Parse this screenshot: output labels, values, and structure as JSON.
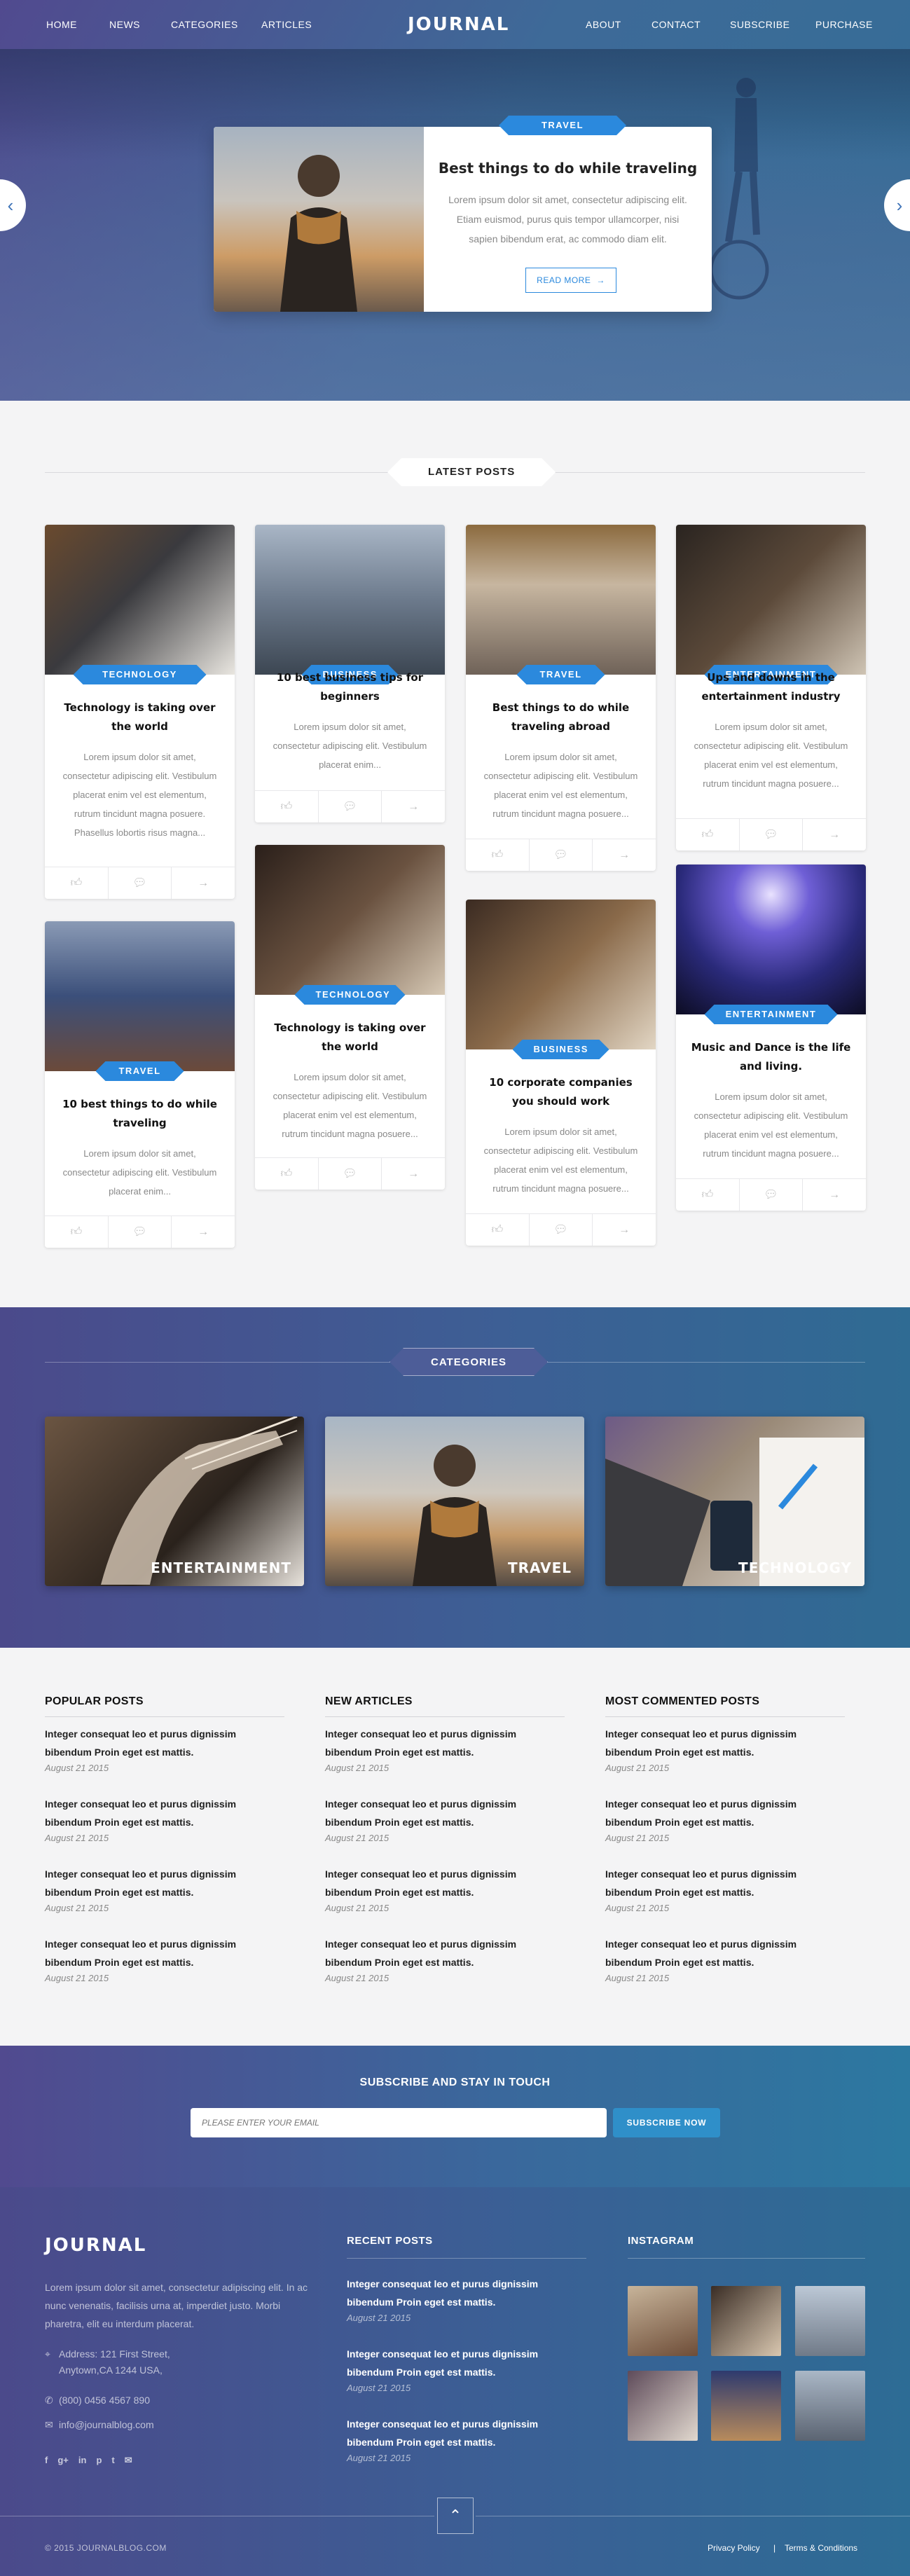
{
  "nav": {
    "left": [
      "HOME",
      "NEWS",
      "CATEGORIES",
      "ARTICLES"
    ],
    "logo": "JOURNAL",
    "right": [
      "ABOUT",
      "CONTACT",
      "SUBSCRIBE",
      "PURCHASE"
    ]
  },
  "feature": {
    "tag": "TRAVEL",
    "title": "Best things to do while traveling",
    "excerpt": "Lorem ipsum dolor sit amet, consectetur adipiscing elit. Etiam euismod, purus quis tempor ullamcorper, nisi sapien bibendum erat, ac commodo diam elit.",
    "read_more": "READ MORE",
    "prev_icon": "chevron-left-icon",
    "next_icon": "chevron-right-icon"
  },
  "latest": {
    "heading": "LATEST POSTS",
    "cards": [
      {
        "tag": "TECHNOLOGY",
        "title": "Technology is taking over the world",
        "excerpt": "Lorem ipsum dolor sit amet, consectetur adipiscing elit. Vestibulum placerat enim vel est elementum, rutrum tincidunt magna posuere. Phasellus lobortis risus magna..."
      },
      {
        "tag": "BUSINESS",
        "title": "10 best business tips for beginners",
        "excerpt": "Lorem ipsum dolor sit amet, consectetur adipiscing elit. Vestibulum placerat enim..."
      },
      {
        "tag": "TRAVEL",
        "title": "Best things to do while traveling abroad",
        "excerpt": "Lorem ipsum dolor sit amet, consectetur adipiscing elit. Vestibulum placerat enim vel est elementum, rutrum tincidunt magna posuere..."
      },
      {
        "tag": "ENTERTAINMENT",
        "title": "Ups and downs in the entertainment industry",
        "excerpt": "Lorem ipsum dolor sit amet, consectetur adipiscing elit. Vestibulum placerat enim vel est elementum, rutrum tincidunt magna posuere..."
      },
      {
        "tag": "TRAVEL",
        "title": "10 best things to do while traveling",
        "excerpt": "Lorem ipsum dolor sit amet, consectetur adipiscing elit. Vestibulum placerat enim..."
      },
      {
        "tag": "TECHNOLOGY",
        "title": "Technology is taking over the world",
        "excerpt": "Lorem ipsum dolor sit amet, consectetur adipiscing elit. Vestibulum placerat enim vel est elementum, rutrum tincidunt magna posuere..."
      },
      {
        "tag": "BUSINESS",
        "title": "10 corporate companies you should work",
        "excerpt": "Lorem ipsum dolor sit amet, consectetur adipiscing elit. Vestibulum placerat enim vel est elementum, rutrum tincidunt magna posuere..."
      },
      {
        "tag": "ENTERTAINMENT",
        "title": "Music and Dance is the life and living.",
        "excerpt": "Lorem ipsum dolor sit amet, consectetur adipiscing elit. Vestibulum placerat enim vel est elementum, rutrum tincidunt magna posuere..."
      }
    ],
    "footer_icons": [
      "thumbs-up-icon",
      "comment-icon",
      "arrow-right-icon"
    ]
  },
  "categories": {
    "heading": "CATEGORIES",
    "items": [
      "ENTERTAINMENT",
      "TRAVEL",
      "TECHNOLOGY"
    ]
  },
  "lists": {
    "columns": [
      {
        "heading": "POPULAR POSTS"
      },
      {
        "heading": "NEW ARTICLES"
      },
      {
        "heading": "MOST COMMENTED POSTS"
      }
    ],
    "item_title": "Integer consequat leo et purus dignissim bibendum Proin eget est mattis.",
    "item_date": "August 21 2015"
  },
  "subscribe": {
    "heading": "SUBSCRIBE AND STAY IN TOUCH",
    "placeholder": "PLEASE ENTER YOUR EMAIL",
    "button": "SUBSCRIBE NOW"
  },
  "footer": {
    "logo": "JOURNAL",
    "about": "Lorem ipsum dolor sit amet, consectetur adipiscing elit. In ac nunc venenatis, facilisis urna at, imperdiet justo. Morbi pharetra, elit eu interdum placerat.",
    "address_line1": "Address: 121 First Street,",
    "address_line2": "Anytown,CA 1244 USA,",
    "phone": "(800) 0456 4567 890",
    "email": "info@journalblog.com",
    "social_icons": [
      "facebook-icon",
      "google-plus-icon",
      "linkedin-icon",
      "pinterest-icon",
      "twitter-icon",
      "email-icon"
    ],
    "recent_heading": "RECENT POSTS",
    "recent_title": "Integer consequat leo et purus dignissim bibendum Proin eget est mattis.",
    "recent_date": "August 21 2015",
    "instagram_heading": "INSTAGRAM",
    "copyright": "© 2015 JOURNALBLOG.COM",
    "privacy": "Privacy Policy",
    "separator": "|",
    "terms": "Terms & Conditions"
  },
  "colors": {
    "accent": "#2b89dd",
    "hero_start": "#514a8f",
    "hero_end": "#2f6b93"
  }
}
